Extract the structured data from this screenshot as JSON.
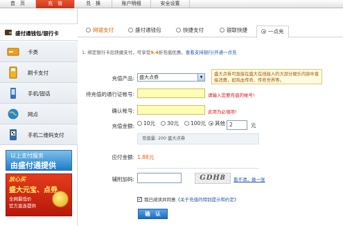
{
  "nav": {
    "items": [
      {
        "label": "首　页"
      },
      {
        "label": "充　值"
      },
      {
        "label": "兑　换"
      },
      {
        "label": "账户明细"
      },
      {
        "label": "安全设置"
      }
    ]
  },
  "sidebar": {
    "top_label": "盛付通钱包/银行卡",
    "items": [
      {
        "label": "卡类",
        "icon": "card-icon"
      },
      {
        "label": "刷卡支付",
        "icon": "pos-icon"
      },
      {
        "label": "手机/固话",
        "icon": "phone-icon"
      },
      {
        "label": "网点",
        "icon": "globe-icon"
      },
      {
        "label": "手机二维码支付",
        "icon": "qrcode-icon"
      }
    ],
    "ad_blue": {
      "line1": "以上支付服务",
      "line2": "由盛付通提供"
    },
    "ad_red": {
      "line1": "放心买",
      "line2": "盛大元宝、点券",
      "line3": "全网最低价",
      "line4": "官方直连提供"
    }
  },
  "tabs": [
    {
      "label": "网银支付"
    },
    {
      "label": "盛付通钱包"
    },
    {
      "label": "快捷支付"
    },
    {
      "label": "银联快捷"
    },
    {
      "label": "一点充"
    }
  ],
  "note": {
    "prefix": "1. 绑定银行卡后快捷支付，可享受",
    "rate": "9.4",
    "suffix": "折充值优惠。",
    "link": "查看支持银行|开通一点充"
  },
  "form": {
    "product_label": "充值产品:",
    "product_value": "盛大点券",
    "product_tip": "盛大点券可直接在盛大在线接入的大部分娱乐内容中直接消费，如热血传奇、传奇世界等。",
    "account_label": "待充值的通行证帐号:",
    "account_error": "请输入您要充值的帐号!",
    "confirm_label": "确认帐号:",
    "confirm_error": "此项为必填项!",
    "amount_label": "充值金额:",
    "amount_options": [
      {
        "label": "10元"
      },
      {
        "label": "30元"
      },
      {
        "label": "100元"
      },
      {
        "label": "其他"
      }
    ],
    "amount_value": "2",
    "amount_unit": "元",
    "credit_text": "充值量: 200 盛大点券",
    "pay_label": "应付金额:",
    "pay_value": "1.88元",
    "captcha_label": "辅附加码:",
    "captcha_text": "GDH8",
    "captcha_refresh": "看不清，换一张",
    "agree_prefix": "我已阅读并同意",
    "agree_link": "《关于充值的特别提示和约定》",
    "submit_label": "确　认"
  }
}
